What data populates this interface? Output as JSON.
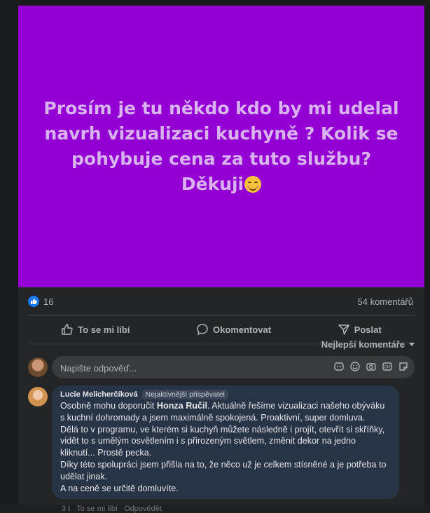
{
  "post": {
    "text": "Prosím je tu někdo kdo by mi udelal navrh vizualizaci kuchyně ? Kolik se pohybuje cena za tuto službu? Děkuji",
    "text_emoji": "smiling-face-icon",
    "background_color": "#9400d3"
  },
  "stats": {
    "like_count": "16",
    "comments": "54 komentářů"
  },
  "actions": {
    "like": "To se mi líbí",
    "comment": "Okomentovat",
    "share": "Poslat"
  },
  "sort": {
    "label": "Nejlepší komentáře"
  },
  "reply": {
    "placeholder": "Napište odpověď..."
  },
  "comment": {
    "author": "Lucie Melicherčíková",
    "badge": "Nejaktivnější přispěvatel",
    "line1_pre": "Osobně mohu doporučit ",
    "line1_bold": "Honza Ručil",
    "line1_post": ". Aktuálně řešíme vizualizaci našeho obýváku s kuchní dohromady a jsem maximálně spokojená. Proaktivní, super domluva.",
    "line2": "Dělá to v programu, ve kterém si kuchyň můžete následně i projít, otevřít si skříňky, vidět to s umělým osvětlením i s přirozeným světlem, změnit dekor na jedno kliknutí... Prostě pecka.",
    "line3": "Díky této spolupráci jsem přišla na to, že něco už je celkem stísněné a je potřeba to udělat jinak.",
    "line4": "A na ceně se určitě domluvíte."
  },
  "meta": {
    "time": "3 t",
    "like": "To se mi líbí",
    "reply": "Odpovědět"
  },
  "colors": {
    "like_blue": "#1877f2",
    "comment_bubble": "#273445"
  }
}
